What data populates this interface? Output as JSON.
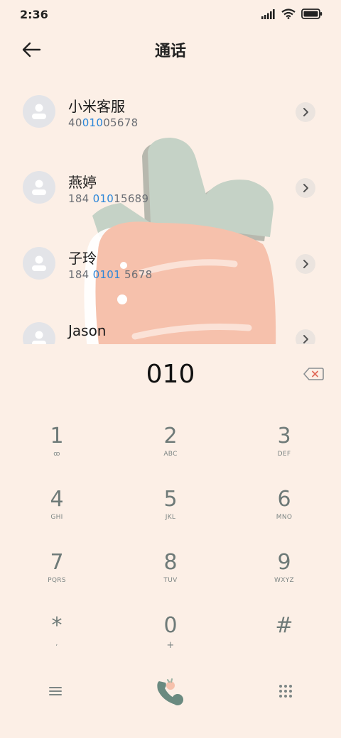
{
  "status": {
    "time": "2:36",
    "icons": [
      "signal-icon",
      "wifi-icon",
      "battery-icon"
    ]
  },
  "header": {
    "title": "通话",
    "back_icon": "arrow-left-icon"
  },
  "contacts": [
    {
      "name": "小米客服",
      "number_parts": [
        "40",
        "010",
        "05678"
      ]
    },
    {
      "name": "燕婷",
      "number_parts": [
        "184 ",
        "010",
        "15689"
      ]
    },
    {
      "name": "子玲",
      "number_parts": [
        "184 ",
        "0101",
        " 5678"
      ]
    },
    {
      "name": "Jason",
      "number_parts": [
        "",
        "",
        ""
      ]
    }
  ],
  "dialer": {
    "input": "010",
    "keys": [
      {
        "digit": "1",
        "letters": "ꝏ"
      },
      {
        "digit": "2",
        "letters": "ABC"
      },
      {
        "digit": "3",
        "letters": "DEF"
      },
      {
        "digit": "4",
        "letters": "GHI"
      },
      {
        "digit": "5",
        "letters": "JKL"
      },
      {
        "digit": "6",
        "letters": "MNO"
      },
      {
        "digit": "7",
        "letters": "PQRS"
      },
      {
        "digit": "8",
        "letters": "TUV"
      },
      {
        "digit": "9",
        "letters": "WXYZ"
      },
      {
        "digit": "*",
        "letters": ","
      },
      {
        "digit": "0",
        "letters": "+"
      },
      {
        "digit": "#",
        "letters": ""
      }
    ]
  },
  "colors": {
    "background": "#fcefe6",
    "highlight": "#2b86d9",
    "key_text": "#6e7a78",
    "call_green": "#6a8a80"
  }
}
